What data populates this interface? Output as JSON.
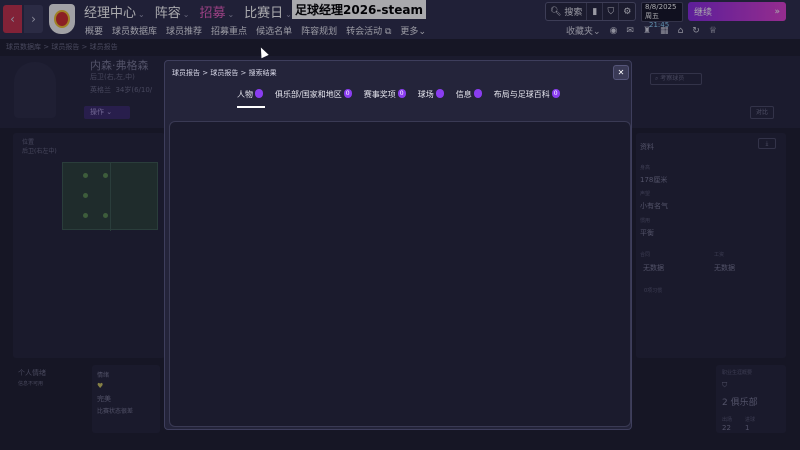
{
  "window_title": "足球经理2026-steam",
  "topbar": {
    "back_icon": "chevron-left-icon",
    "forward_icon": "chevron-right-icon",
    "main_nav": [
      {
        "label": "经理中心",
        "active": false
      },
      {
        "label": "阵容",
        "active": false
      },
      {
        "label": "招募",
        "active": true
      },
      {
        "label": "比赛日",
        "active": false
      },
      {
        "label": "俱",
        "active": false
      }
    ],
    "sub_nav": [
      "概要",
      "球员数据库",
      "球员推荐",
      "招募重点",
      "候选名单",
      "阵容规划",
      "转会活动",
      "更多"
    ],
    "search_label": "搜索",
    "date": "8/8/2025",
    "weekday": "周五",
    "time": "21:45",
    "continue_label": "继续",
    "favorites_label": "收藏夹",
    "accent_color": "#e85fbf",
    "continue_gradient": [
      "#8a2be2",
      "#e040d0"
    ]
  },
  "background": {
    "breadcrumb": "球员数据库 > 球员报告 > 球员报告",
    "player_name": "内森·弗格森",
    "player_position": "后卫(右,左,中)",
    "player_nationality": "英格兰",
    "player_age": "34岁(6/10/",
    "action_button": "操作",
    "scout_button": "考察球员",
    "compare_button": "对比",
    "position_label": "位置",
    "position_value": "后卫(右左中)",
    "right_panel": {
      "section": "资料",
      "height_label": "身高",
      "height_value": "178厘米",
      "reputation_label": "声望",
      "reputation_value": "小有名气",
      "foot_label": "惯用",
      "foot_value": "平衡",
      "row4_left_label": "合同",
      "row4_left_value": "无数据",
      "row4_right_label": "工资",
      "row4_right_value": "无数据",
      "habits": "0项习惯",
      "career_title": "职业生涯概要",
      "career_clubs": "2 俱乐部",
      "career_apps_label": "出场",
      "career_apps": "22",
      "career_goals_label": "进球",
      "career_goals": "1"
    },
    "bottom_left_title": "个人情绪",
    "bottom_left_sub": "信息不可用",
    "card_title": "情绪",
    "card_value": "完美",
    "card_desc": "比赛状态很差"
  },
  "modal": {
    "breadcrumb": "球员报告 > 球员报告 > 搜索结果",
    "close_icon": "close-icon",
    "tabs": [
      {
        "label": "人物",
        "count": "",
        "active": true
      },
      {
        "label": "俱乐部/国家和地区",
        "count": "0",
        "active": false
      },
      {
        "label": "赛事奖项",
        "count": "0",
        "active": false
      },
      {
        "label": "球场",
        "count": "",
        "active": false
      },
      {
        "label": "信息",
        "count": "",
        "active": false
      },
      {
        "label": "布局与足球百科",
        "count": "0",
        "active": false
      }
    ]
  }
}
